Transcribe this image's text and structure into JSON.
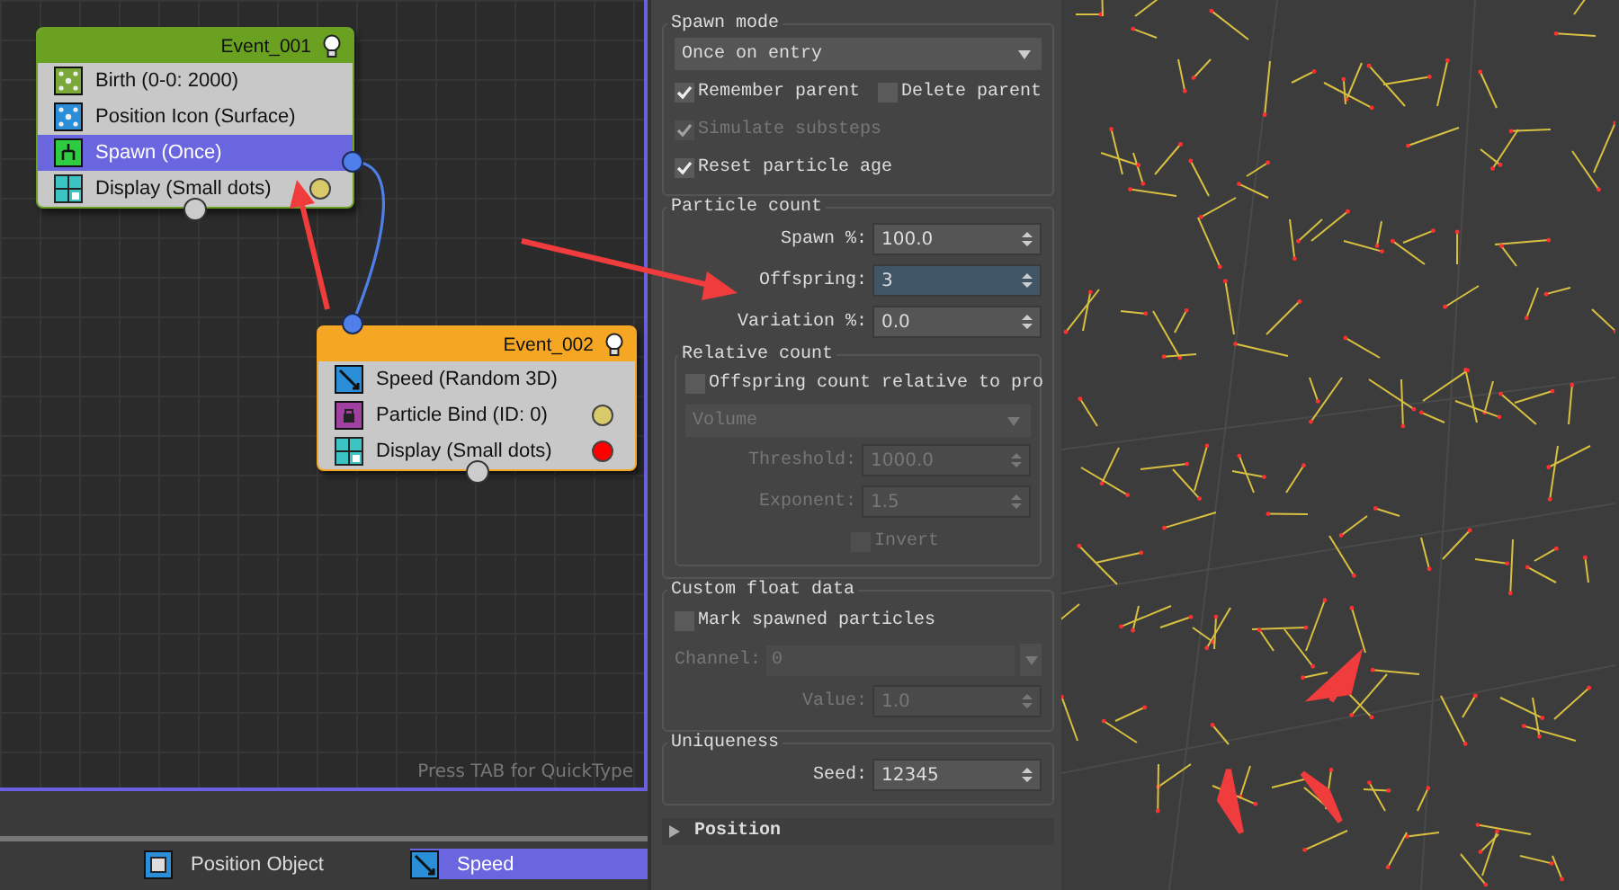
{
  "graph": {
    "nodes": [
      {
        "title": "Event_001",
        "color": "#6aa121",
        "rows": [
          {
            "label": "Birth (0-0: 2000)",
            "kind": "birth",
            "selected": false
          },
          {
            "label": "Position Icon (Surface)",
            "kind": "position",
            "selected": false
          },
          {
            "label": "Spawn (Once)",
            "kind": "spawn",
            "selected": true
          },
          {
            "label": "Display (Small dots)",
            "kind": "display",
            "selected": false,
            "color": "#d8c96a"
          }
        ]
      },
      {
        "title": "Event_002",
        "color": "#f5a623",
        "rows": [
          {
            "label": "Speed (Random 3D)",
            "kind": "speed",
            "selected": false
          },
          {
            "label": "Particle Bind (ID: 0)",
            "kind": "bind",
            "selected": false,
            "color": "#d8c96a"
          },
          {
            "label": "Display (Small dots)",
            "kind": "display",
            "selected": false,
            "color": "#ff0000"
          }
        ]
      }
    ],
    "hint": "Press TAB for QuickType"
  },
  "depot": [
    {
      "label": "Position Object",
      "kind": "position_object",
      "selected": false
    },
    {
      "label": "Speed",
      "kind": "speed",
      "selected": true
    }
  ],
  "rollout": {
    "groups": [
      {
        "title": "Spawn mode",
        "items": [
          {
            "kind": "dropdown",
            "value": "Once on entry",
            "disabled": false
          },
          {
            "kind": "checks",
            "checks": [
              {
                "label": "Remember parent",
                "checked": true,
                "disabled": false
              },
              {
                "label": "Delete parent",
                "checked": false,
                "disabled": false
              }
            ]
          },
          {
            "kind": "checks",
            "checks": [
              {
                "label": "Simulate substeps",
                "checked": true,
                "disabled": true
              }
            ]
          },
          {
            "kind": "checks",
            "checks": [
              {
                "label": "Reset particle age",
                "checked": true,
                "disabled": false
              }
            ]
          }
        ]
      },
      {
        "title": "Particle count",
        "items": [
          {
            "kind": "spinner",
            "label": "Spawn %:",
            "value": "100.0",
            "selected": false,
            "disabled": false
          },
          {
            "kind": "spinner",
            "label": "Offspring:",
            "value": "3",
            "selected": true,
            "disabled": false
          },
          {
            "kind": "spinner",
            "label": "Variation %:",
            "value": "0.0",
            "selected": false,
            "disabled": false
          },
          {
            "kind": "group",
            "title": "Relative count",
            "items": [
              {
                "kind": "checks",
                "checks": [
                  {
                    "label": "Offspring count relative to pro",
                    "checked": false,
                    "disabled": false
                  }
                ]
              },
              {
                "kind": "dropdown",
                "value": "Volume",
                "disabled": true
              },
              {
                "kind": "spinner",
                "label": "Threshold:",
                "value": "1000.0",
                "selected": false,
                "disabled": true
              },
              {
                "kind": "spinner",
                "label": "Exponent:",
                "value": "1.5",
                "selected": false,
                "disabled": true
              },
              {
                "kind": "field_check",
                "checks": [
                  {
                    "label": "Invert",
                    "checked": false,
                    "disabled": true
                  }
                ]
              }
            ]
          }
        ]
      },
      {
        "title": "Custom float data",
        "items": [
          {
            "kind": "checks",
            "checks": [
              {
                "label": "Mark spawned particles",
                "checked": false,
                "disabled": false
              }
            ]
          },
          {
            "kind": "combo",
            "label": "Channel:",
            "value": "0",
            "disabled": true
          },
          {
            "kind": "spinner",
            "label": "Value:",
            "value": "1.0",
            "selected": false,
            "disabled": true
          }
        ]
      },
      {
        "title": "Uniqueness",
        "items": [
          {
            "kind": "spinner",
            "label": "Seed:",
            "value": "12345",
            "selected": false,
            "disabled": false
          }
        ]
      }
    ],
    "collapsed": [
      {
        "title": "Position",
        "expanded": false
      }
    ]
  }
}
